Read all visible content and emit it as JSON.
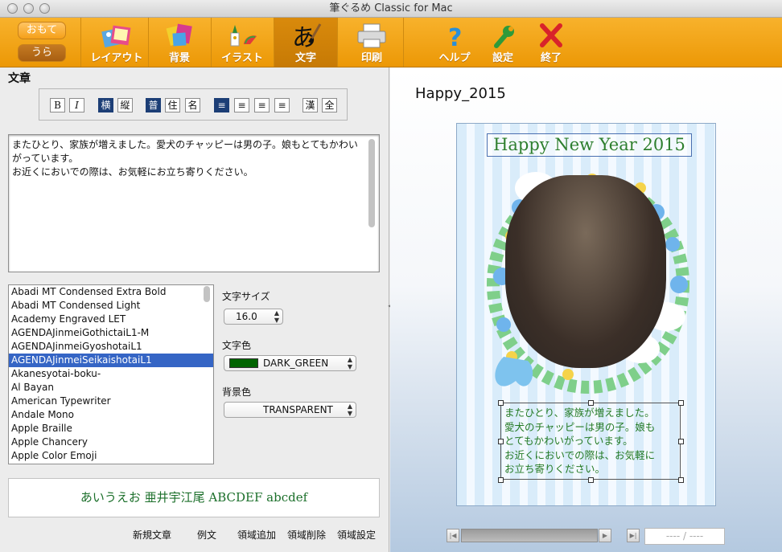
{
  "window": {
    "title": "筆ぐるめ Classic for Mac"
  },
  "side_toggle": {
    "front": "おもて",
    "back": "うら"
  },
  "toolbar": {
    "layout": "レイアウト",
    "background": "背景",
    "illust": "イラスト",
    "text": "文字",
    "print": "印刷",
    "help": "ヘルプ",
    "settings": "設定",
    "quit": "終了"
  },
  "panel": {
    "section_title": "文章",
    "format_buttons": [
      "B",
      "I",
      "横",
      "縦",
      "普",
      "住",
      "名",
      "≡",
      "≡",
      "≡",
      "≡",
      "漢",
      "全"
    ],
    "text_content": "またひとり、家族が増えました。愛犬のチャッピーは男の子。娘もとてもかわいがっています。\nお近くにおいでの際は、お気軽にお立ち寄りください。",
    "fonts": [
      "Abadi MT Condensed Extra Bold",
      "Abadi MT Condensed Light",
      "Academy Engraved LET",
      "AGENDAJinmeiGothictaiL1-M",
      "AGENDAJinmeiGyoshotaiL1",
      "AGENDAJinmeiSeikaishotaiL1",
      "Akanesyotai-boku-",
      "Al Bayan",
      "American Typewriter",
      "Andale Mono",
      "Apple Braille",
      "Apple Chancery",
      "Apple Color Emoji"
    ],
    "selected_font_index": 5,
    "font_size_label": "文字サイズ",
    "font_size_value": "16.0",
    "text_color_label": "文字色",
    "text_color_value": "DARK_GREEN",
    "text_color_hex": "#006400",
    "bg_color_label": "背景色",
    "bg_color_value": "TRANSPARENT",
    "preview_text": "あいうえお 亜井宇江尾 ABCDEF abcdef",
    "actions": {
      "new_text": "新規文章",
      "example": "例文",
      "add_area": "領域追加",
      "delete_area": "領域削除",
      "area_settings": "領域設定"
    }
  },
  "canvas": {
    "card_name": "Happy_2015",
    "headline": "Happy New Year 2015",
    "message": "またひとり、家族が増えました。\n愛犬のチャッピーは男の子。娘も\nとてもかわいがっています。\nお近くにおいでの際は、お気軽に\nお立ち寄りください。",
    "page_field": "---- / ----"
  }
}
